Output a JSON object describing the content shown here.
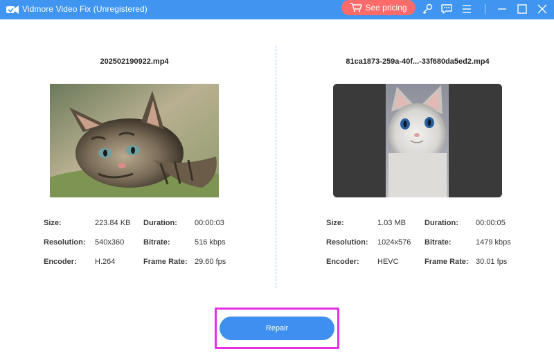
{
  "app": {
    "title": "Vidmore Video Fix (Unregistered)",
    "accent_color": "#3f95f0",
    "pricing_label": "See pricing",
    "pricing_color": "#ff6b6b"
  },
  "titlebar_icons": [
    "cart-icon",
    "key-icon",
    "feedback-icon",
    "menu-icon",
    "minimize-icon",
    "maximize-icon",
    "close-icon"
  ],
  "left": {
    "file_name": "202502190922.mp4",
    "thumbnail": "tabby-kitten-photo",
    "size_label": "Size:",
    "size_value": "223.84 KB",
    "resolution_label": "Resolution:",
    "resolution_value": "540x360",
    "encoder_label": "Encoder:",
    "encoder_value": "H.264",
    "duration_label": "Duration:",
    "duration_value": "00:00:03",
    "bitrate_label": "Bitrate:",
    "bitrate_value": "516 kbps",
    "framerate_label": "Frame Rate:",
    "framerate_value": "29.60 fps"
  },
  "right": {
    "file_name": "81ca1873-259a-40f...-33f680da5ed2.mp4",
    "thumbnail": "white-kitten-photo",
    "size_label": "Size:",
    "size_value": "1.03 MB",
    "resolution_label": "Resolution:",
    "resolution_value": "1024x576",
    "encoder_label": "Encoder:",
    "encoder_value": "HEVC",
    "duration_label": "Duration:",
    "duration_value": "00:00:05",
    "bitrate_label": "Bitrate:",
    "bitrate_value": "1479 kbps",
    "framerate_label": "Frame Rate:",
    "framerate_value": "30.01 fps"
  },
  "repair_label": "Repair",
  "highlight_color": "#e52ee8"
}
